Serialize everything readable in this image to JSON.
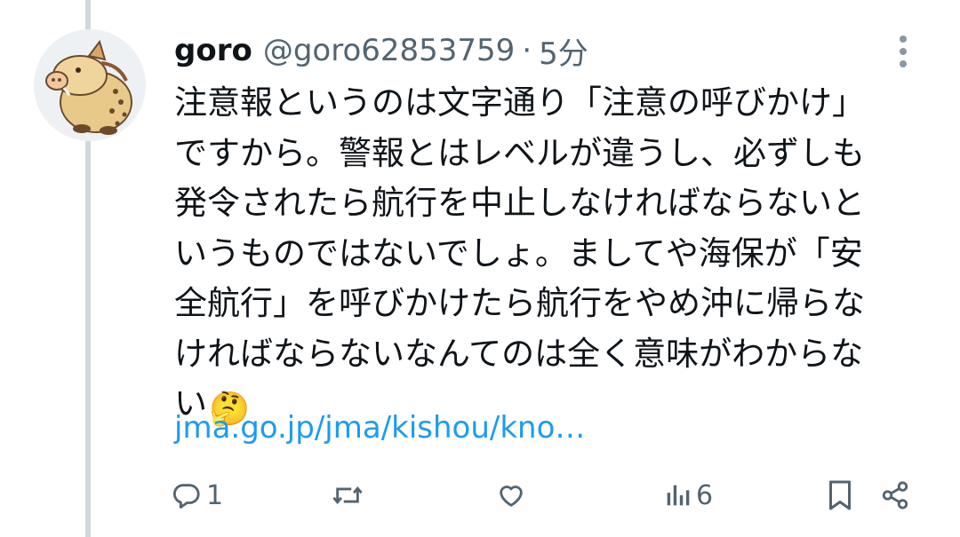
{
  "tweet": {
    "name": "goro",
    "handle": "@goro62853759",
    "separator": "·",
    "time": "5分",
    "text_lines": [
      "注意報というのは文字通り「注意の呼びかけ」",
      "ですから。警報とはレベルが違うし、必ずしも",
      "発令されたら航行を中止しなければならないと",
      "いうものではないでしょ。ましてや海保が「安",
      "全航行」を呼びかけたら航行をやめ沖に帰らな",
      "ければならないなんてのは全く意味がわからな",
      "い"
    ],
    "emoji": "🤔",
    "link": "jma.go.jp/jma/kishou/kno…"
  },
  "actions": {
    "reply_count": "1",
    "views_count": "6"
  },
  "icons": {
    "more": "more-vertical-icon",
    "reply": "reply-icon",
    "retweet": "retweet-icon",
    "like": "heart-icon",
    "views": "views-icon",
    "bookmark": "bookmark-icon",
    "share": "share-icon"
  },
  "colors": {
    "text": "#0f1419",
    "secondary": "#536471",
    "link": "#1d9bf0",
    "thread_line": "#cfd9de"
  }
}
